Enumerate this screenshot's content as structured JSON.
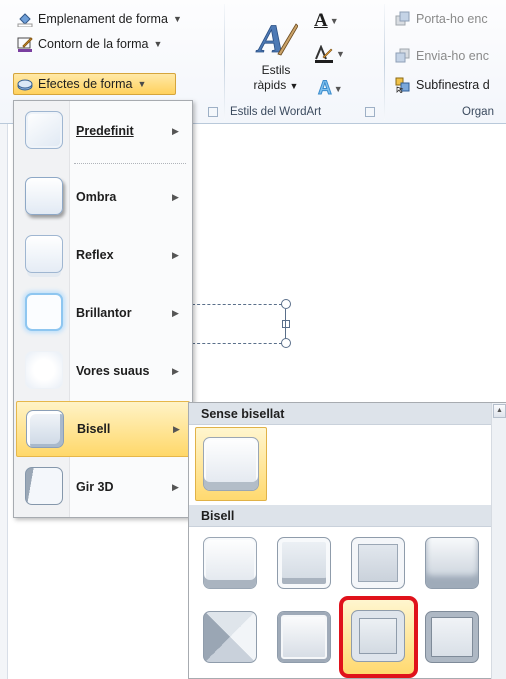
{
  "ribbon": {
    "shape_styles": {
      "fill_label": "Emplenament de forma",
      "outline_label": "Contorn de la forma",
      "effects_label": "Efectes de forma"
    },
    "wordart": {
      "quick_styles_line1": "Estils",
      "quick_styles_line2": "ràpids",
      "group_label": "Estils del WordArt"
    },
    "arrange": {
      "bring_forward": "Porta-ho enc",
      "send_backward": "Envia-ho enc",
      "selection_pane": "Subfinestra d",
      "group_label": "Organ"
    }
  },
  "effects_menu": {
    "items": [
      {
        "label": "Predefinit",
        "icon": "preset-effect-icon"
      },
      {
        "label": "Ombra",
        "icon": "shadow-effect-icon"
      },
      {
        "label": "Reflex",
        "icon": "reflection-effect-icon"
      },
      {
        "label": "Brillantor",
        "icon": "glow-effect-icon"
      },
      {
        "label": "Vores suaus",
        "icon": "soft-edges-effect-icon"
      },
      {
        "label": "Bisell",
        "icon": "bevel-effect-icon"
      },
      {
        "label": "Gir 3D",
        "icon": "3d-rotation-effect-icon"
      }
    ],
    "hovered": "Bisell"
  },
  "bevel_submenu": {
    "no_bevel_header": "Sense bisellat",
    "bevel_header": "Bisell",
    "highlighted_index": 6
  },
  "colors": {
    "accent_hover": "#ffd86a",
    "highlight_ring": "#e0121b"
  }
}
